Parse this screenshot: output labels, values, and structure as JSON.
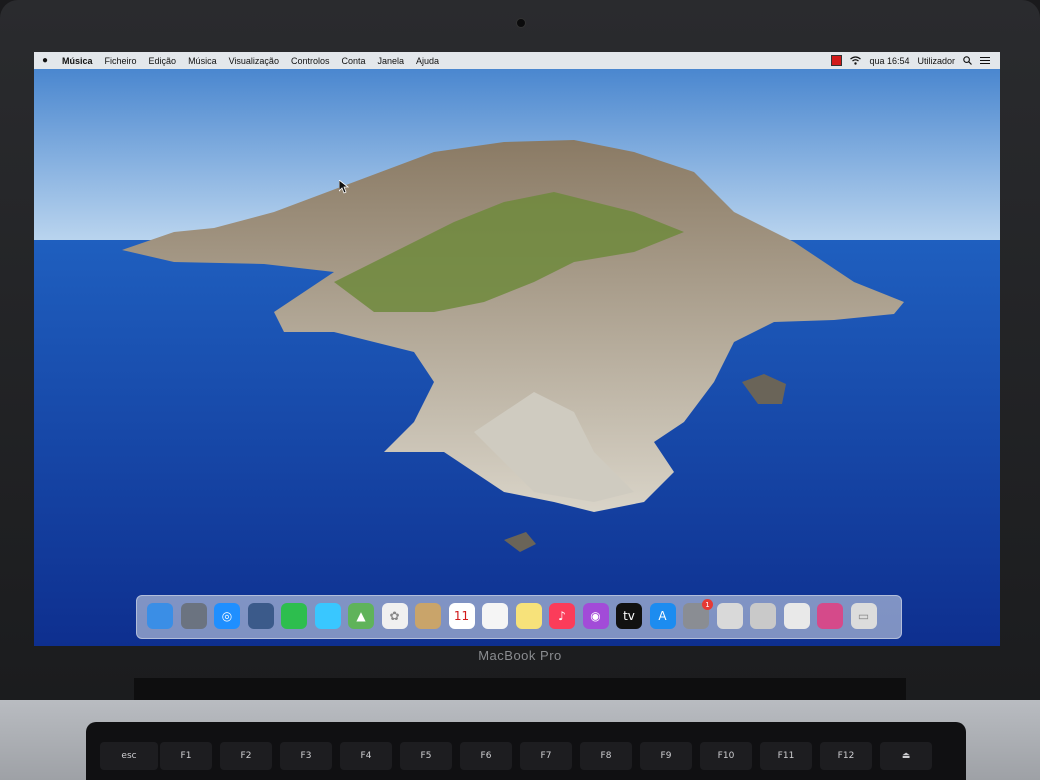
{
  "device": {
    "brand": "MacBook Pro"
  },
  "menubar": {
    "apple_icon": "apple-icon",
    "items": [
      "Música",
      "Ficheiro",
      "Edição",
      "Música",
      "Visualização",
      "Controlos",
      "Conta",
      "Janela",
      "Ajuda"
    ],
    "clock": "qua 16:54",
    "user": "Utilizador",
    "status_icons": [
      "flag-icon",
      "wifi-icon",
      "search-icon",
      "list-icon"
    ]
  },
  "dock": {
    "apps": [
      {
        "name": "finder-icon",
        "color": "#3a8ee6"
      },
      {
        "name": "launchpad-icon",
        "color": "#6b7380"
      },
      {
        "name": "safari-icon",
        "color": "#1f8fff"
      },
      {
        "name": "photo-booth-icon",
        "color": "#3b5a8a"
      },
      {
        "name": "facetime-icon",
        "color": "#2dbe4e"
      },
      {
        "name": "messages-icon",
        "color": "#39c7ff"
      },
      {
        "name": "maps-icon",
        "color": "#5fb35a"
      },
      {
        "name": "photos-icon",
        "color": "#f0f0f0"
      },
      {
        "name": "contacts-icon",
        "color": "#c9a46a"
      },
      {
        "name": "calendar-icon",
        "color": "#ffffff",
        "label": "11"
      },
      {
        "name": "reminders-icon",
        "color": "#f5f5f5"
      },
      {
        "name": "notes-icon",
        "color": "#f7e27a"
      },
      {
        "name": "music-icon",
        "color": "#fb3c5a"
      },
      {
        "name": "podcasts-icon",
        "color": "#a24bd8"
      },
      {
        "name": "tv-icon",
        "color": "#111111",
        "label": "tv"
      },
      {
        "name": "app-store-icon",
        "color": "#1c8cf0"
      },
      {
        "name": "system-preferences-icon",
        "color": "#8a8d93",
        "badge": "1"
      },
      {
        "name": "script-editor-icon",
        "color": "#d9d9d9"
      },
      {
        "name": "utility-app-icon",
        "color": "#c9c9c9"
      },
      {
        "name": "documents-icon",
        "color": "#e9e9e9"
      },
      {
        "name": "screenshot-icon",
        "color": "#d54a8a"
      },
      {
        "name": "trash-icon",
        "color": "#dcdcdc"
      }
    ]
  },
  "keyboard": {
    "keys": [
      "esc",
      "F1",
      "F2",
      "F3",
      "F4",
      "F5",
      "F6",
      "F7",
      "F8",
      "F9",
      "F10",
      "F11",
      "F12",
      "⏏"
    ]
  }
}
